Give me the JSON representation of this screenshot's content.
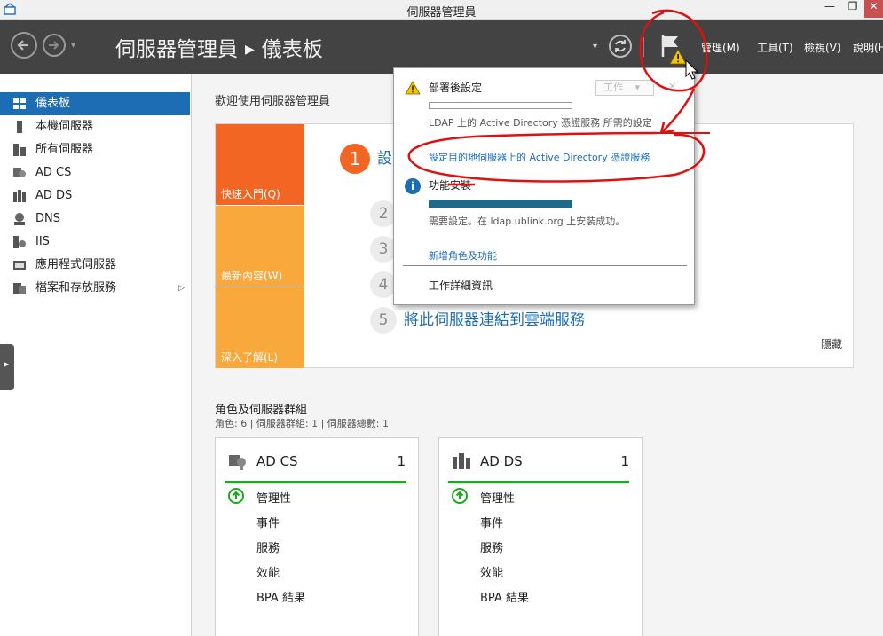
{
  "window": {
    "title": "伺服器管理員",
    "min_glyph": "—",
    "max_glyph": "❐",
    "close_glyph": "✕",
    "icon": "server-manager-icon"
  },
  "header": {
    "breadcrumb_root": "伺服器管理員",
    "breadcrumb_sep": "▶",
    "breadcrumb_current": "儀表板",
    "nav_dropdown_glyph": "▾",
    "caret_glyph": "▾",
    "menus": [
      "管理(M)",
      "工具(T)",
      "檢視(V)",
      "說明(H)"
    ],
    "icons": [
      "back-icon",
      "forward-icon",
      "refresh-icon",
      "notification-flag-icon",
      "warning-icon"
    ]
  },
  "sidebar": {
    "items": [
      {
        "label": "儀表板",
        "icon": "dashboard-icon",
        "active": true
      },
      {
        "label": "本機伺服器",
        "icon": "server-icon"
      },
      {
        "label": "所有伺服器",
        "icon": "servers-icon"
      },
      {
        "label": "AD CS",
        "icon": "certificate-icon"
      },
      {
        "label": "AD DS",
        "icon": "directory-icon"
      },
      {
        "label": "DNS",
        "icon": "dns-icon"
      },
      {
        "label": "IIS",
        "icon": "iis-icon"
      },
      {
        "label": "應用程式伺服器",
        "icon": "app-server-icon"
      },
      {
        "label": "檔案和存放服務",
        "icon": "file-storage-icon"
      }
    ],
    "expand_glyph": "▷",
    "tab_glyph": "▶"
  },
  "main": {
    "welcome": "歡迎使用伺服器管理員",
    "tiles": [
      "快速入門(Q)",
      "最新內容(W)",
      "深入了解(L)"
    ],
    "steps": [
      {
        "num": "1",
        "text": "設"
      },
      {
        "num": "2",
        "text": ""
      },
      {
        "num": "3",
        "text": ""
      },
      {
        "num": "4",
        "text": ""
      },
      {
        "num": "5",
        "text": "將此伺服器連結到雲端服務"
      }
    ],
    "hide": "隱藏",
    "roles_title": "角色及伺服器群組",
    "roles_sub": "角色: 6 | 伺服器群組: 1 | 伺服器總數: 1",
    "cards": [
      {
        "name": "AD CS",
        "count": "1",
        "icon": "certificate-icon",
        "rows": [
          "管理性",
          "事件",
          "服務",
          "效能",
          "BPA 結果"
        ]
      },
      {
        "name": "AD DS",
        "count": "1",
        "icon": "directory-icon",
        "rows": [
          "管理性",
          "事件",
          "服務",
          "效能",
          "BPA 結果"
        ]
      }
    ],
    "status_color": "#1aab1a"
  },
  "flyout": {
    "task1_title": "部署後設定",
    "task1_button": "工作",
    "task1_button_caret": "▾",
    "task1_close": "✕",
    "task1_progress": 0,
    "task1_desc": "LDAP 上的 Active Directory 憑證服務 所需的設定",
    "task1_link": "設定目的地伺服器上的 Active Directory 憑證服務",
    "task2_title": "功能安裝",
    "task2_progress": 1.0,
    "task2_desc": "需要設定。在 ldap.ublink.org 上安裝成功。",
    "add_roles_link": "新增角色及功能",
    "task_details": "工作詳細資訊"
  },
  "colors": {
    "header_bg": "#434343",
    "accent": "#1d6db4",
    "orange": "#f26522",
    "orange_light": "#f9a83c",
    "annotation": "#e01010"
  }
}
